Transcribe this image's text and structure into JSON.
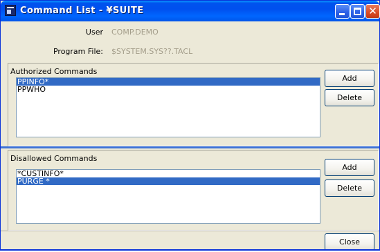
{
  "window": {
    "title": "Command List - ¥SUITE"
  },
  "info": {
    "user_label": "User",
    "user_value": "COMP.DEMO",
    "program_label": "Program File:",
    "program_value": "$SYSTEM.SYS??.TACL"
  },
  "authorized": {
    "title": "Authorized Commands",
    "items": [
      "PPINFO*",
      "PPWHO"
    ],
    "selected": "PPINFO*",
    "add_label": "Add",
    "delete_label": "Delete"
  },
  "disallowed": {
    "title": "Disallowed Commands",
    "items": [
      "*CUSTINFO*",
      "PURGE *"
    ],
    "selected": "PURGE *",
    "add_label": "Add",
    "delete_label": "Delete"
  },
  "footer": {
    "close_label": "Close"
  },
  "colors": {
    "title_bar": "#0053ee",
    "selection": "#316ac5",
    "face": "#ece9d8",
    "muted_text": "#a39d8a"
  }
}
